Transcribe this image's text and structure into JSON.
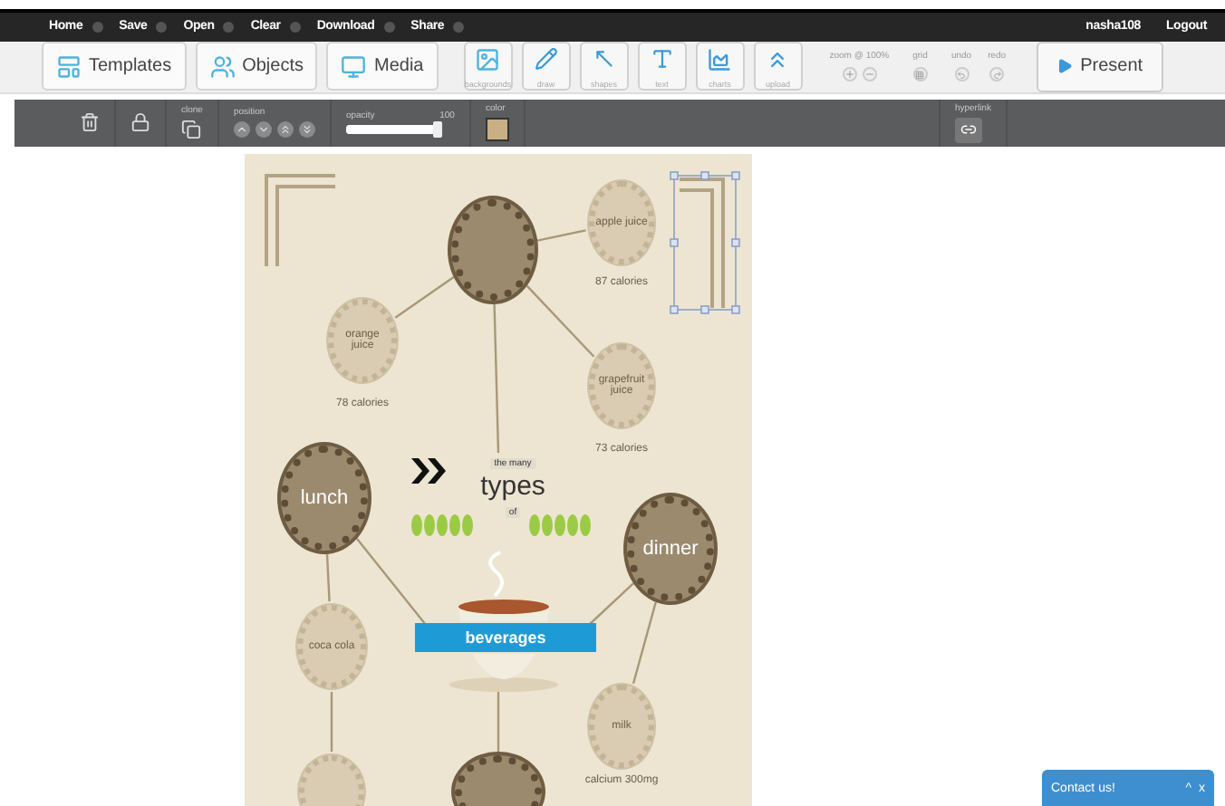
{
  "nav": {
    "menus": [
      "Home",
      "Save",
      "Open",
      "Clear",
      "Download",
      "Share"
    ],
    "user": "nasha108",
    "logout": "Logout"
  },
  "toolbar": {
    "panels": [
      {
        "kind": "templates",
        "label": "Templates"
      },
      {
        "kind": "objects",
        "label": "Objects"
      },
      {
        "kind": "media",
        "label": "Media"
      }
    ],
    "tools": [
      {
        "kind": "backgrounds",
        "label": "backgrounds"
      },
      {
        "kind": "draw",
        "label": "draw"
      },
      {
        "kind": "shapes",
        "label": "shapes"
      },
      {
        "kind": "text",
        "label": "text"
      },
      {
        "kind": "charts",
        "label": "charts"
      },
      {
        "kind": "upload",
        "label": "upload"
      }
    ],
    "zoom_label": "zoom @ 100%",
    "grid_label": "grid",
    "undo_label": "undo",
    "redo_label": "redo",
    "present": "Present"
  },
  "properties": {
    "clone_label": "clone",
    "position_label": "position",
    "opacity_label": "opacity",
    "opacity_reading": "100",
    "opacity": {
      "level": 1
    },
    "color_label": "color",
    "color": "#c8af86",
    "hyperlink_label": "hyperlink"
  },
  "poster": {
    "title_lines": [
      "the many",
      "types",
      "of"
    ],
    "banner": "beverages",
    "nodes": [
      {
        "kind": "meal"
      },
      {
        "kind": "drink",
        "label": "apple juice",
        "caption": "87 calories"
      },
      {
        "kind": "drink",
        "label": "orange juice",
        "caption": "78 calories"
      },
      {
        "kind": "drink",
        "label": "grapefruit juice",
        "caption": "73 calories"
      },
      {
        "kind": "meal",
        "label": "lunch"
      },
      {
        "kind": "meal",
        "label": "dinner"
      },
      {
        "kind": "drink",
        "label": "coca cola"
      },
      {
        "kind": "drink",
        "label": "milk",
        "caption": "calcium 300mg"
      },
      {
        "kind": "drink"
      },
      {
        "kind": "meal"
      }
    ]
  },
  "contact": {
    "label": "Contact us!",
    "minimize": "^",
    "close": "x"
  }
}
